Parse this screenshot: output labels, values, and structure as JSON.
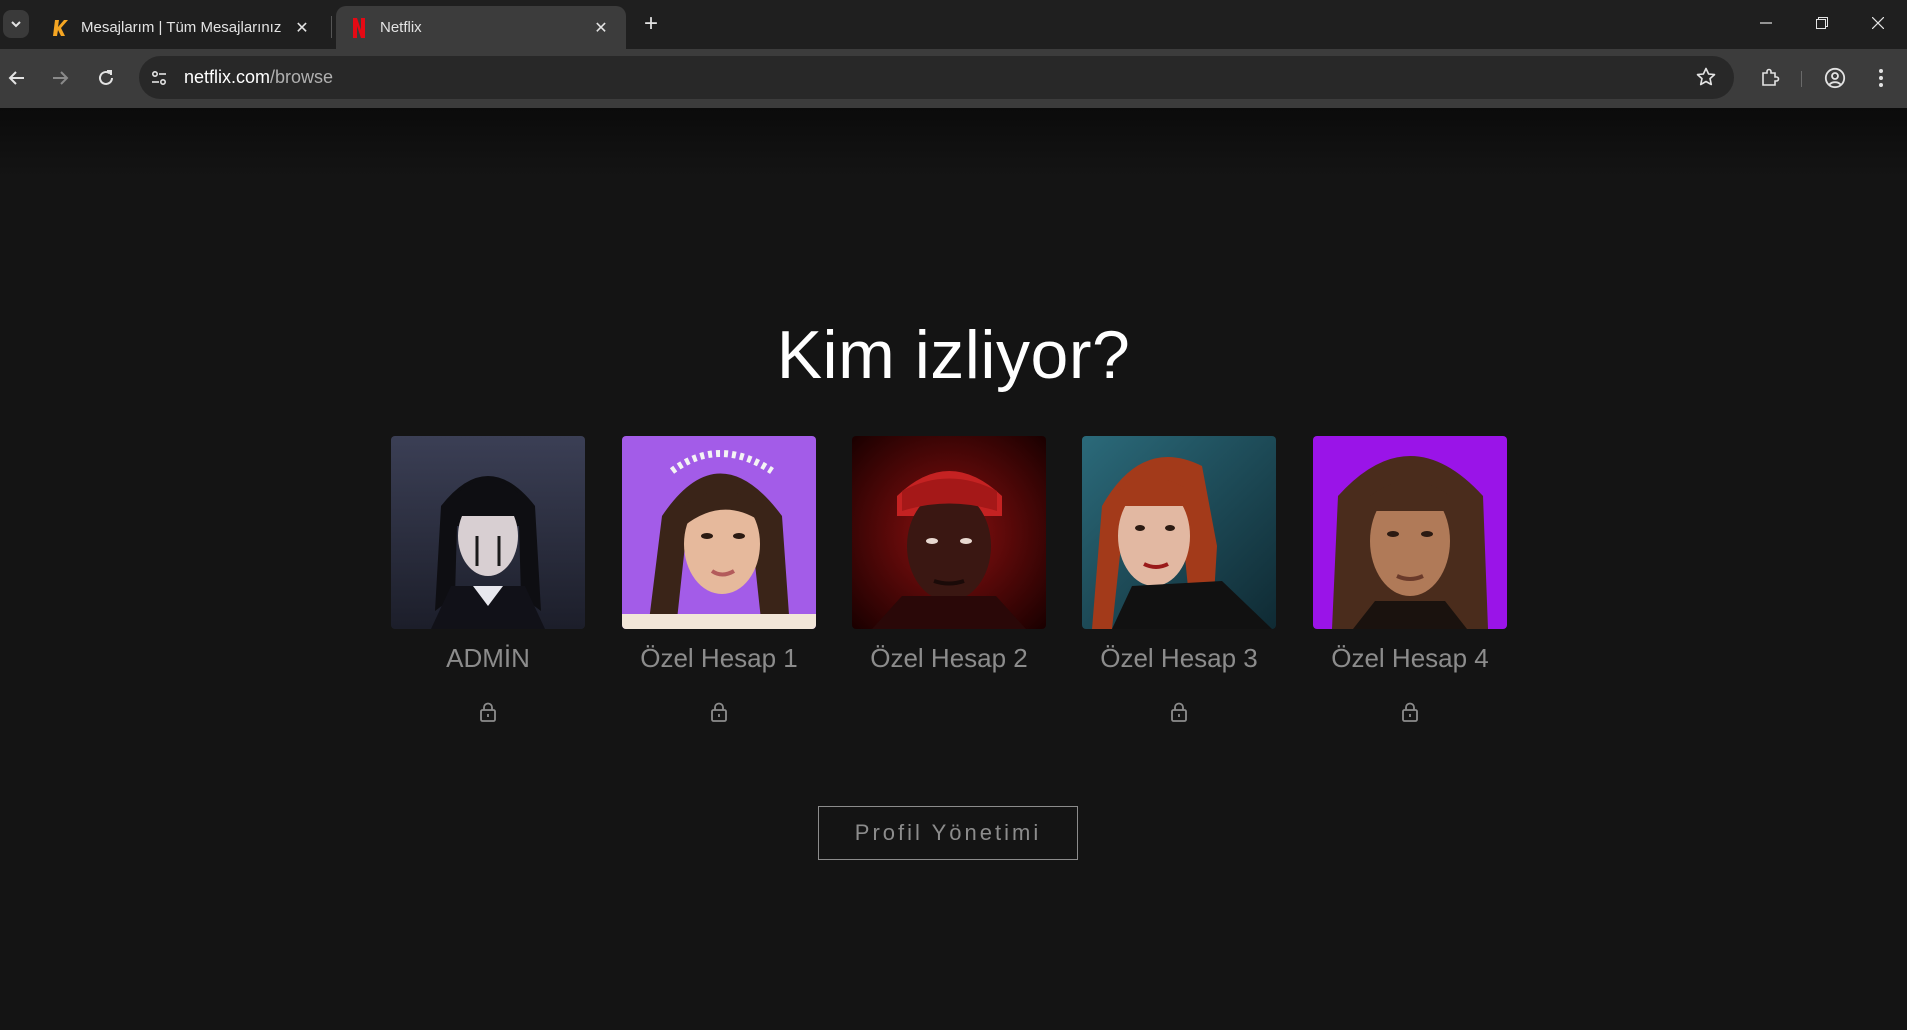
{
  "browser": {
    "tabs": [
      {
        "title": "Mesajlarım | Tüm Mesajlarınız",
        "favicon": "kariyer-k-icon",
        "active": false
      },
      {
        "title": "Netflix",
        "favicon": "netflix-n-icon",
        "active": true
      }
    ],
    "address": {
      "host": "netflix.com",
      "path": "/browse"
    }
  },
  "page": {
    "heading": "Kim izliyor?",
    "profiles": [
      {
        "name": "ADMİN",
        "locked": true,
        "avatar_bg": "#2a2d3e"
      },
      {
        "name": "Özel Hesap 1",
        "locked": true,
        "avatar_bg": "#a35ce8"
      },
      {
        "name": "Özel Hesap 2",
        "locked": false,
        "avatar_bg": "#7a0a0a"
      },
      {
        "name": "Özel Hesap 3",
        "locked": true,
        "avatar_bg": "#1f4f5e"
      },
      {
        "name": "Özel Hesap 4",
        "locked": true,
        "avatar_bg": "#9a14e8"
      }
    ],
    "manage_button": "Profil Yönetimi"
  },
  "colors": {
    "background": "#141414",
    "muted_text": "#8c8c8c",
    "netflix_red": "#e50914"
  }
}
